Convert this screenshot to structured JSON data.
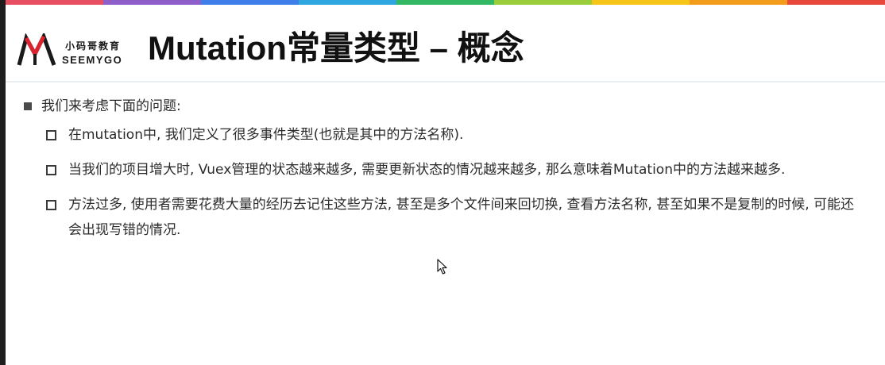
{
  "header": {
    "logo": {
      "name_cn": "小码哥教育",
      "name_en": "SEEMYGO",
      "mark_icon": "seemygo-m-logo-icon"
    },
    "title": "Mutation常量类型 – 概念"
  },
  "content": {
    "intro": "我们来考虑下面的问题:",
    "points": [
      "在mutation中, 我们定义了很多事件类型(也就是其中的方法名称).",
      "当我们的项目增大时, Vuex管理的状态越来越多, 需要更新状态的情况越来越多, 那么意味着Mutation中的方法越来越多.",
      "方法过多, 使用者需要花费大量的经历去记住这些方法, 甚至是多个文件间来回切换, 查看方法名称, 甚至如果不是复制的时候, 可能还会出现写错的情况."
    ]
  },
  "colors": {
    "stripe": [
      "#e94f63",
      "#8e5fc9",
      "#3f7ee8",
      "#2fa6e0",
      "#33b863",
      "#9acd3c",
      "#f5c518",
      "#f39c1c",
      "#e8483b"
    ],
    "logo_red": "#d9232e",
    "text": "#2b2b2b",
    "title": "#111111"
  },
  "icons": {
    "pointer": "mouse-cursor-icon"
  }
}
